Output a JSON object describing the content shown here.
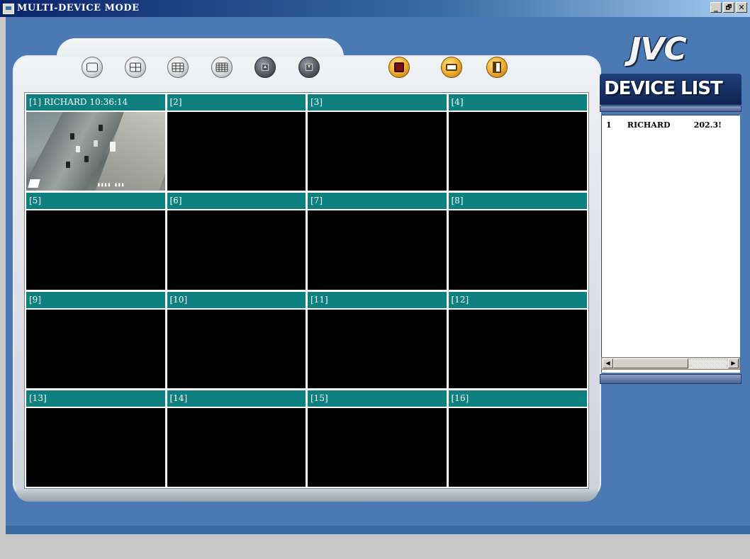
{
  "window": {
    "title": "MULTI-DEVICE MODE",
    "controls": [
      "_",
      "🗗",
      "✕"
    ]
  },
  "toolbar": {
    "buttons": [
      {
        "name": "layout-1x1-button",
        "icon": "single-view-icon"
      },
      {
        "name": "layout-2x2-button",
        "icon": "quad-view-icon"
      },
      {
        "name": "layout-3x3-button",
        "icon": "nine-view-icon"
      },
      {
        "name": "layout-4x4-button",
        "icon": "sixteen-view-icon"
      },
      {
        "name": "page-up-button",
        "icon": "arrow-up-icon"
      },
      {
        "name": "page-down-button",
        "icon": "arrow-down-icon"
      },
      {
        "name": "record-button",
        "icon": "record-icon"
      },
      {
        "name": "device-settings-button",
        "icon": "monitor-icon"
      },
      {
        "name": "exit-button",
        "icon": "exit-door-icon"
      }
    ]
  },
  "cells": [
    {
      "label": "[1]  RICHARD   10:36:14",
      "has_video": true
    },
    {
      "label": "[2]"
    },
    {
      "label": "[3]"
    },
    {
      "label": "[4]"
    },
    {
      "label": "[5]"
    },
    {
      "label": "[6]"
    },
    {
      "label": "[7]"
    },
    {
      "label": "[8]"
    },
    {
      "label": "[9]"
    },
    {
      "label": "[10]"
    },
    {
      "label": "[11]"
    },
    {
      "label": "[12]"
    },
    {
      "label": "[13]"
    },
    {
      "label": "[14]"
    },
    {
      "label": "[15]"
    },
    {
      "label": "[16]"
    }
  ],
  "brand": {
    "logo_text": "JVC"
  },
  "device_list": {
    "title": "DEVICE LIST",
    "rows": [
      {
        "num": "1",
        "name": "RICHARD",
        "ip": "202.3!"
      }
    ],
    "scroll_left": "◀",
    "scroll_right": "▶"
  }
}
